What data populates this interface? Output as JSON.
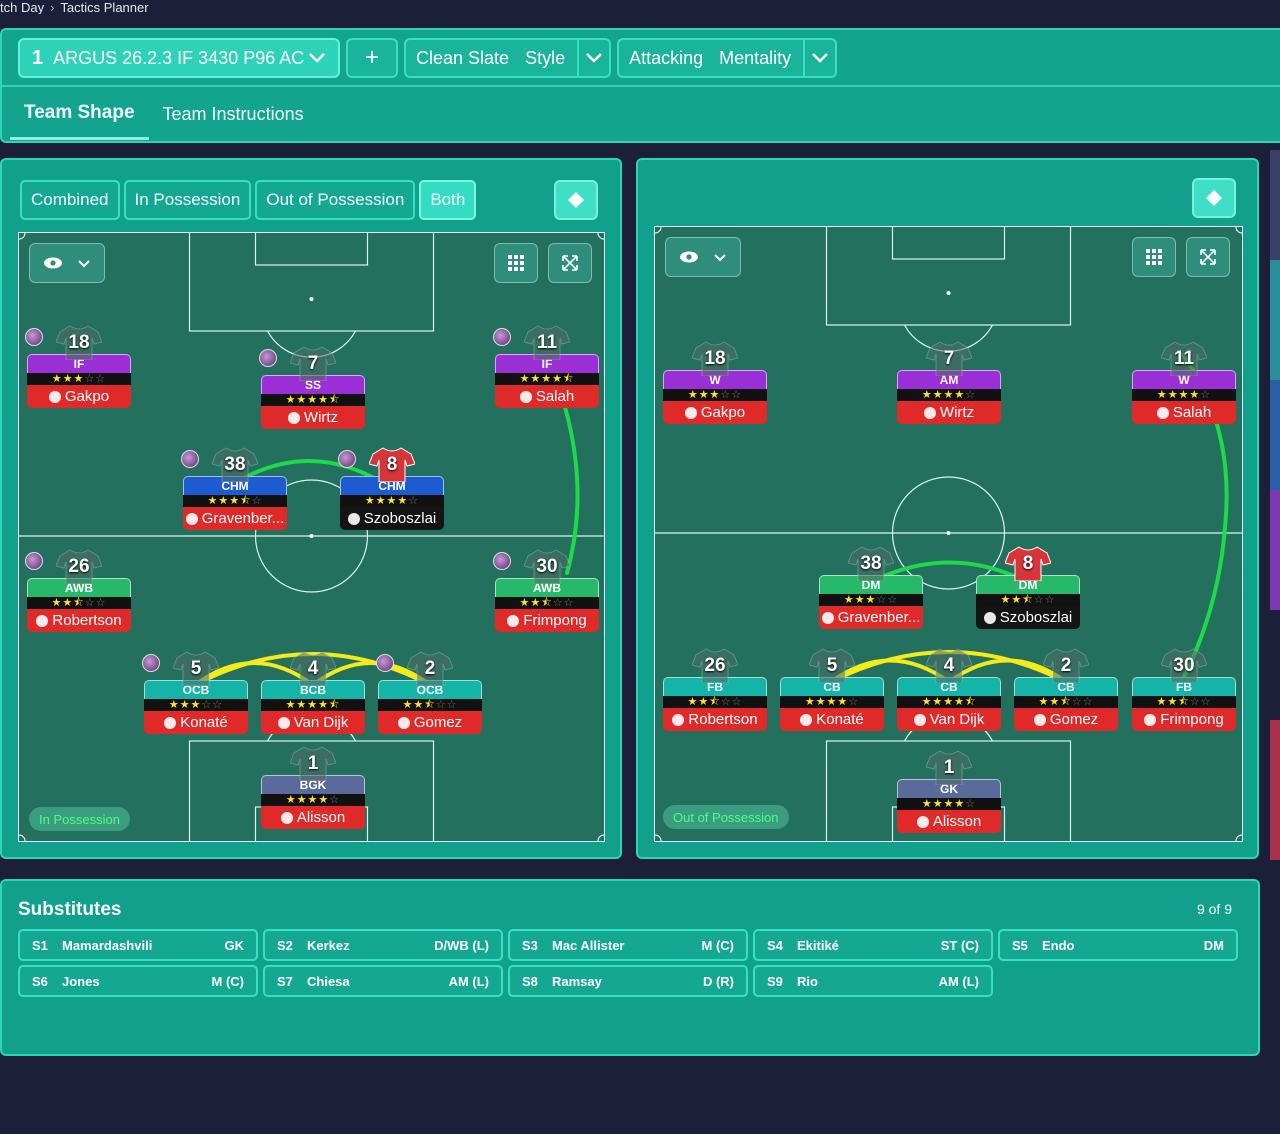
{
  "breadcrumb": [
    "tch Day",
    "Tactics Planner"
  ],
  "topbar": {
    "tactic_num": "1",
    "tactic_name": "ARGUS 26.2.3 IF 3430 P96 AC",
    "add_label": "+",
    "style_value": "Clean Slate",
    "style_label": "Style",
    "mentality_value": "Attacking",
    "mentality_label": "Mentality"
  },
  "tabs": [
    "Team Shape",
    "Team Instructions"
  ],
  "filters": [
    "Combined",
    "In Possession",
    "Out of Possession",
    "Both"
  ],
  "left_pitch": {
    "phase": "In Possession",
    "players": [
      {
        "num": "18",
        "role": "IF",
        "color": "purple",
        "stars": 3.0,
        "name": "Gakpo",
        "ball": true
      },
      {
        "num": "7",
        "role": "SS",
        "color": "purple",
        "stars": 4.5,
        "name": "Wirtz",
        "ball": true
      },
      {
        "num": "11",
        "role": "IF",
        "color": "purple",
        "stars": 4.5,
        "name": "Salah",
        "ball": true
      },
      {
        "num": "38",
        "role": "CHM",
        "color": "blue",
        "stars": 3.5,
        "name": "Gravenber...",
        "ball": true
      },
      {
        "num": "8",
        "role": "CHM",
        "color": "blue",
        "stars": 4.0,
        "name": "Szoboszlai",
        "ball": true,
        "red_shirt": true,
        "dark": true
      },
      {
        "num": "26",
        "role": "AWB",
        "color": "green",
        "stars": 2.5,
        "name": "Robertson",
        "ball": true
      },
      {
        "num": "30",
        "role": "AWB",
        "color": "green",
        "stars": 2.5,
        "name": "Frimpong",
        "ball": true
      },
      {
        "num": "5",
        "role": "OCB",
        "color": "teal",
        "stars": 3.0,
        "name": "Konaté",
        "ball": true
      },
      {
        "num": "4",
        "role": "BCB",
        "color": "teal",
        "stars": 4.5,
        "name": "Van Dijk",
        "ball": false
      },
      {
        "num": "2",
        "role": "OCB",
        "color": "teal",
        "stars": 2.5,
        "name": "Gomez",
        "ball": true
      },
      {
        "num": "1",
        "role": "BGK",
        "color": "slate",
        "stars": 4.0,
        "name": "Alisson",
        "ball": false
      }
    ]
  },
  "right_pitch": {
    "phase": "Out of Possession",
    "players": [
      {
        "num": "18",
        "role": "W",
        "color": "purple",
        "stars": 3.0,
        "name": "Gakpo"
      },
      {
        "num": "7",
        "role": "AM",
        "color": "purple",
        "stars": 4.0,
        "name": "Wirtz"
      },
      {
        "num": "11",
        "role": "W",
        "color": "purple",
        "stars": 4.0,
        "name": "Salah"
      },
      {
        "num": "38",
        "role": "DM",
        "color": "green",
        "stars": 3.0,
        "name": "Gravenber..."
      },
      {
        "num": "8",
        "role": "DM",
        "color": "green",
        "stars": 2.5,
        "name": "Szoboszlai",
        "red_shirt": true,
        "dark": true
      },
      {
        "num": "26",
        "role": "FB",
        "color": "teal",
        "stars": 2.5,
        "name": "Robertson"
      },
      {
        "num": "5",
        "role": "CB",
        "color": "teal",
        "stars": 4.0,
        "name": "Konaté"
      },
      {
        "num": "4",
        "role": "CB",
        "color": "teal",
        "stars": 4.5,
        "name": "Van Dijk"
      },
      {
        "num": "2",
        "role": "CB",
        "color": "teal",
        "stars": 2.5,
        "name": "Gomez"
      },
      {
        "num": "30",
        "role": "FB",
        "color": "teal",
        "stars": 2.5,
        "name": "Frimpong"
      },
      {
        "num": "1",
        "role": "GK",
        "color": "slate",
        "stars": 4.0,
        "name": "Alisson"
      }
    ]
  },
  "subs": {
    "title": "Substitutes",
    "count": "9 of 9",
    "items": [
      {
        "slot": "S1",
        "name": "Mamardashvili",
        "pos": "GK"
      },
      {
        "slot": "S2",
        "name": "Kerkez",
        "pos": "D/WB (L)"
      },
      {
        "slot": "S3",
        "name": "Mac Allister",
        "pos": "M (C)"
      },
      {
        "slot": "S4",
        "name": "Ekitiké",
        "pos": "ST (C)"
      },
      {
        "slot": "S5",
        "name": "Endo",
        "pos": "DM"
      },
      {
        "slot": "S6",
        "name": "Jones",
        "pos": "M (C)"
      },
      {
        "slot": "S7",
        "name": "Chiesa",
        "pos": "AM (L)"
      },
      {
        "slot": "S8",
        "name": "Ramsay",
        "pos": "D (R)"
      },
      {
        "slot": "S9",
        "name": "Rio",
        "pos": "AM (L)"
      }
    ]
  },
  "colors": {
    "panel": "#10a08b",
    "pitch": "#23705f",
    "accent": "#2dd4b8"
  }
}
